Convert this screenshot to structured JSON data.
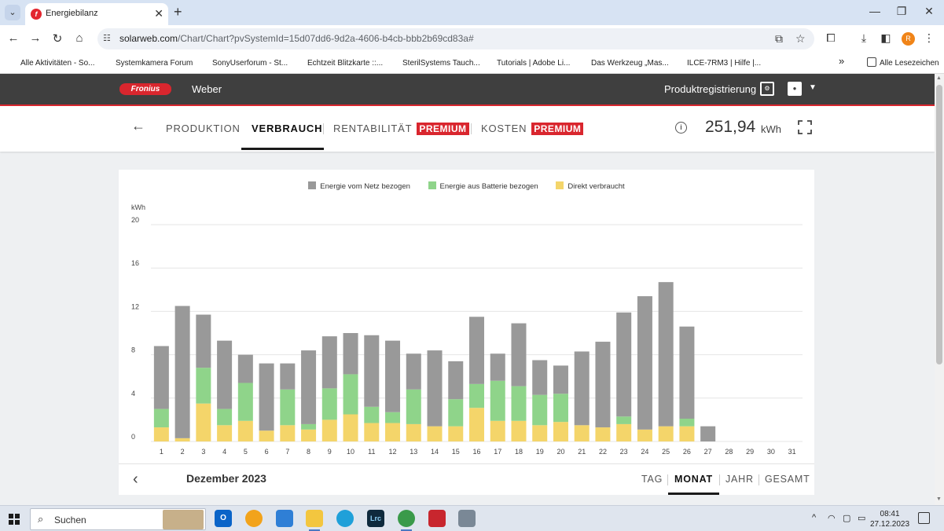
{
  "browser": {
    "tab_title": "Energiebilanz",
    "url_domain": "solarweb.com",
    "url_path": "/Chart/Chart?pvSystemId=15d07dd6-9d2a-4606-b4cb-bbb2b69cd83a#",
    "profile_initial": "R",
    "bookmarks": [
      {
        "label": "Alle Aktivitäten - So...",
        "color": "#555555"
      },
      {
        "label": "Systemkamera Forum",
        "color": "#e8833a"
      },
      {
        "label": "SonyUserforum - St...",
        "color": "#e87b1f"
      },
      {
        "label": "Echtzeit Blitzkarte ::...",
        "color": "#1f1f1f"
      },
      {
        "label": "SterilSystems Tauch...",
        "color": "#b3121b"
      },
      {
        "label": "Tutorials | Adobe Li...",
        "color": "#e1251b"
      },
      {
        "label": "Das Werkzeug „Mas...",
        "color": "#e1251b"
      },
      {
        "label": "ILCE-7RM3 | Hilfe |...",
        "color": "#555555"
      }
    ],
    "bookmarks_overflow": "»",
    "all_bookmarks": "Alle Lesezeichen"
  },
  "header": {
    "logo_text": "Fronius",
    "system_name": "Weber",
    "product_registration": "Produktregistrierung"
  },
  "tabs": {
    "produktion": "PRODUKTION",
    "verbrauch": "VERBRAUCH",
    "rentabilitaet": "RENTABILITÄT",
    "kosten": "KOSTEN",
    "premium": "PREMIUM",
    "total_value": "251,94",
    "total_unit": "kWh"
  },
  "footer": {
    "period": "Dezember 2023",
    "tag": "TAG",
    "monat": "MONAT",
    "jahr": "JAHR",
    "gesamt": "GESAMT"
  },
  "chart_data": {
    "type": "bar",
    "stacked": true,
    "unit_label": "kWh",
    "ylim": [
      0,
      20
    ],
    "yticks": [
      0,
      4,
      8,
      12,
      16,
      20
    ],
    "legend_position": "top-center",
    "categories": [
      "1",
      "2",
      "3",
      "4",
      "5",
      "6",
      "7",
      "8",
      "9",
      "10",
      "11",
      "12",
      "13",
      "14",
      "15",
      "16",
      "17",
      "18",
      "19",
      "20",
      "21",
      "22",
      "23",
      "24",
      "25",
      "26",
      "27",
      "28",
      "29",
      "30",
      "31"
    ],
    "series": [
      {
        "name": "Direkt verbraucht",
        "color": "#f4d56a",
        "values": [
          1.3,
          0.3,
          3.5,
          1.5,
          1.9,
          1.0,
          1.5,
          1.1,
          2.0,
          2.5,
          1.7,
          1.7,
          1.6,
          1.4,
          1.4,
          3.1,
          1.9,
          1.9,
          1.5,
          1.8,
          1.5,
          1.3,
          1.6,
          1.1,
          1.4,
          1.4,
          0,
          0,
          0,
          0,
          0
        ]
      },
      {
        "name": "Energie aus Batterie bezogen",
        "color": "#8fd48a",
        "values": [
          1.7,
          0,
          3.3,
          1.5,
          3.5,
          0,
          3.3,
          0.5,
          2.9,
          3.7,
          1.5,
          1.0,
          3.2,
          0,
          2.5,
          2.2,
          3.7,
          3.2,
          2.8,
          2.6,
          0,
          0,
          0.7,
          0,
          0,
          0.7,
          0,
          0,
          0,
          0,
          0
        ]
      },
      {
        "name": "Energie vom Netz bezogen",
        "color": "#999999",
        "values": [
          5.8,
          12.2,
          4.9,
          6.3,
          2.6,
          6.2,
          2.4,
          6.8,
          4.8,
          3.8,
          6.6,
          6.6,
          3.3,
          7.0,
          3.5,
          6.2,
          2.5,
          5.8,
          3.2,
          2.6,
          6.8,
          7.9,
          9.6,
          12.3,
          13.3,
          8.5,
          1.4,
          0,
          0,
          0,
          0
        ]
      }
    ]
  }
}
